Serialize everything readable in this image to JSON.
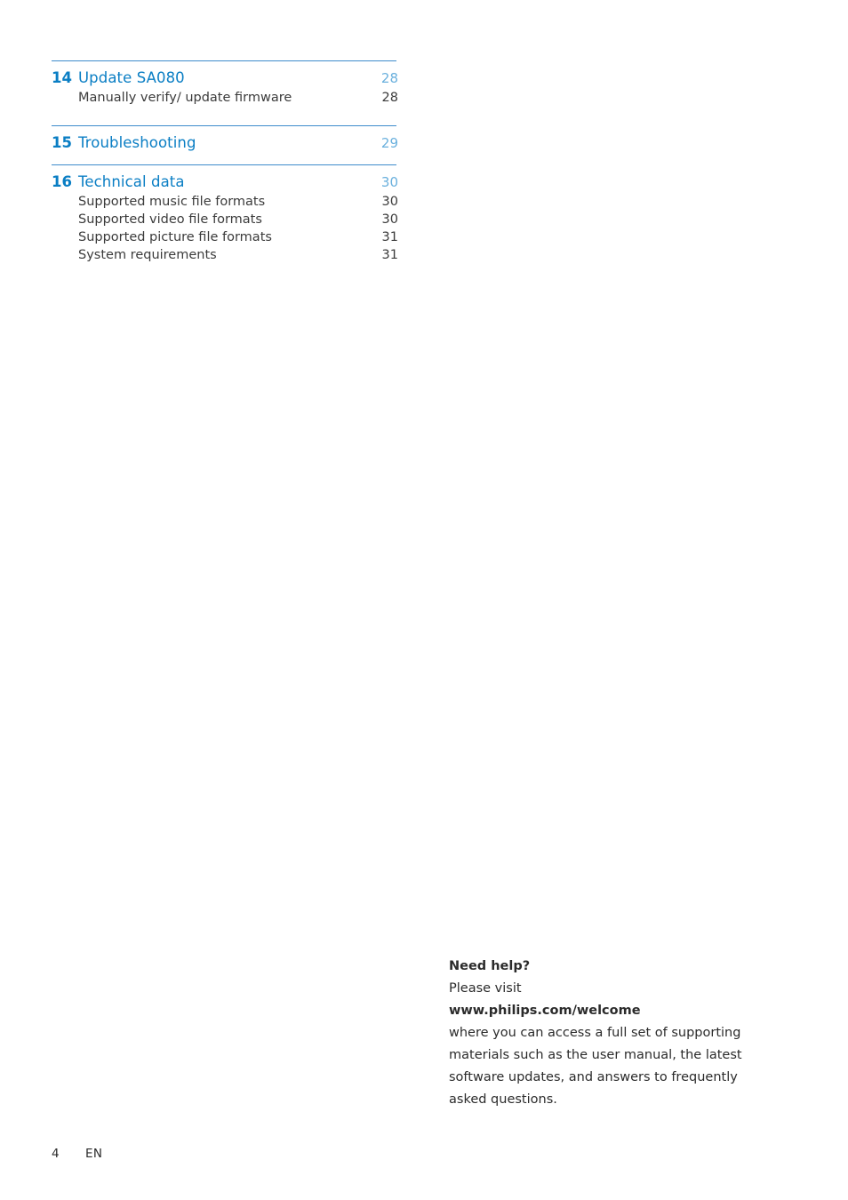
{
  "document": {
    "footer": {
      "page_number": "4",
      "language": "EN"
    }
  },
  "toc": {
    "groups": [
      {
        "chapter": {
          "number": "14",
          "title": "Update SA080",
          "page": "28"
        },
        "entries": [
          {
            "title": "Manually verify/ update firmware",
            "page": "28"
          }
        ]
      },
      {
        "chapter": {
          "number": "15",
          "title": "Troubleshooting",
          "page": "29"
        },
        "entries": []
      },
      {
        "chapter": {
          "number": "16",
          "title": "Technical data",
          "page": "30"
        },
        "entries": [
          {
            "title": "Supported music file formats",
            "page": "30"
          },
          {
            "title": "Supported video file formats",
            "page": "30"
          },
          {
            "title": "Supported picture file formats",
            "page": "31"
          },
          {
            "title": "System requirements",
            "page": "31"
          }
        ]
      }
    ]
  },
  "help": {
    "heading": "Need help?",
    "line1": "Please visit",
    "url": "www.philips.com/welcome",
    "body_line1": "where you can access a full set of supporting",
    "body_line2": "materials such as the user manual, the latest",
    "body_line3": "software updates, and answers to frequently",
    "body_line4": "asked questions."
  }
}
